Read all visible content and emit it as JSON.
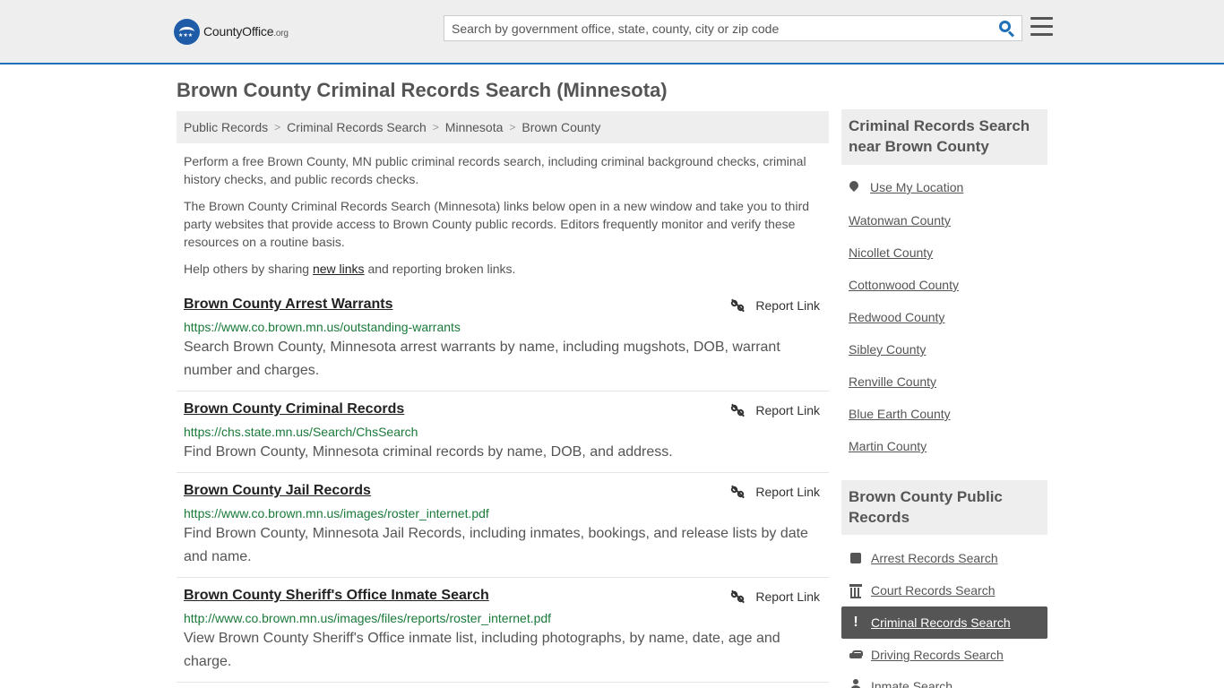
{
  "header": {
    "logo": {
      "brand_a": "County",
      "brand_b": "Office",
      "tld": ".org"
    },
    "search_placeholder": "Search by government office, state, county, city or zip code",
    "accent_color": "#1e70b8"
  },
  "page_title": "Brown County Criminal Records Search (Minnesota)",
  "breadcrumb": [
    "Public Records",
    "Criminal Records Search",
    "Minnesota",
    "Brown County"
  ],
  "intro": {
    "p1": "Perform a free Brown County, MN public criminal records search, including criminal background checks, criminal history checks, and public records checks.",
    "p2": "The Brown County Criminal Records Search (Minnesota) links below open in a new window and take you to third party websites that provide access to Brown County public records. Editors frequently monitor and verify these resources on a routine basis.",
    "p3_before": "Help others by sharing ",
    "p3_link": "new links",
    "p3_after": " and reporting broken links."
  },
  "report_label": "Report Link",
  "results": [
    {
      "title": "Brown County Arrest Warrants",
      "url": "https://www.co.brown.mn.us/outstanding-warrants",
      "desc": "Search Brown County, Minnesota arrest warrants by name, including mugshots, DOB, warrant number and charges."
    },
    {
      "title": "Brown County Criminal Records",
      "url": "https://chs.state.mn.us/Search/ChsSearch",
      "desc": "Find Brown County, Minnesota criminal records by name, DOB, and address."
    },
    {
      "title": "Brown County Jail Records",
      "url": "https://www.co.brown.mn.us/images/roster_internet.pdf",
      "desc": "Find Brown County, Minnesota Jail Records, including inmates, bookings, and release lists by date and name."
    },
    {
      "title": "Brown County Sheriff's Office Inmate Search",
      "url": "http://www.co.brown.mn.us/images/files/reports/roster_internet.pdf",
      "desc": "View Brown County Sheriff's Office inmate list, including photographs, by name, date, age and charge."
    }
  ],
  "sidebar": {
    "nearby_heading": "Criminal Records Search near Brown County",
    "use_location": "Use My Location",
    "nearby": [
      "Watonwan County",
      "Nicollet County",
      "Cottonwood County",
      "Redwood County",
      "Sibley County",
      "Renville County",
      "Blue Earth County",
      "Martin County"
    ],
    "records_heading": "Brown County Public Records",
    "records": [
      {
        "label": "Arrest Records Search",
        "icon": "square-icon"
      },
      {
        "label": "Court Records Search",
        "icon": "courthouse-icon"
      },
      {
        "label": "Criminal Records Search",
        "icon": "exclamation-icon",
        "active": true
      },
      {
        "label": "Driving Records Search",
        "icon": "car-icon"
      },
      {
        "label": "Inmate Search",
        "icon": "person-icon"
      }
    ]
  }
}
